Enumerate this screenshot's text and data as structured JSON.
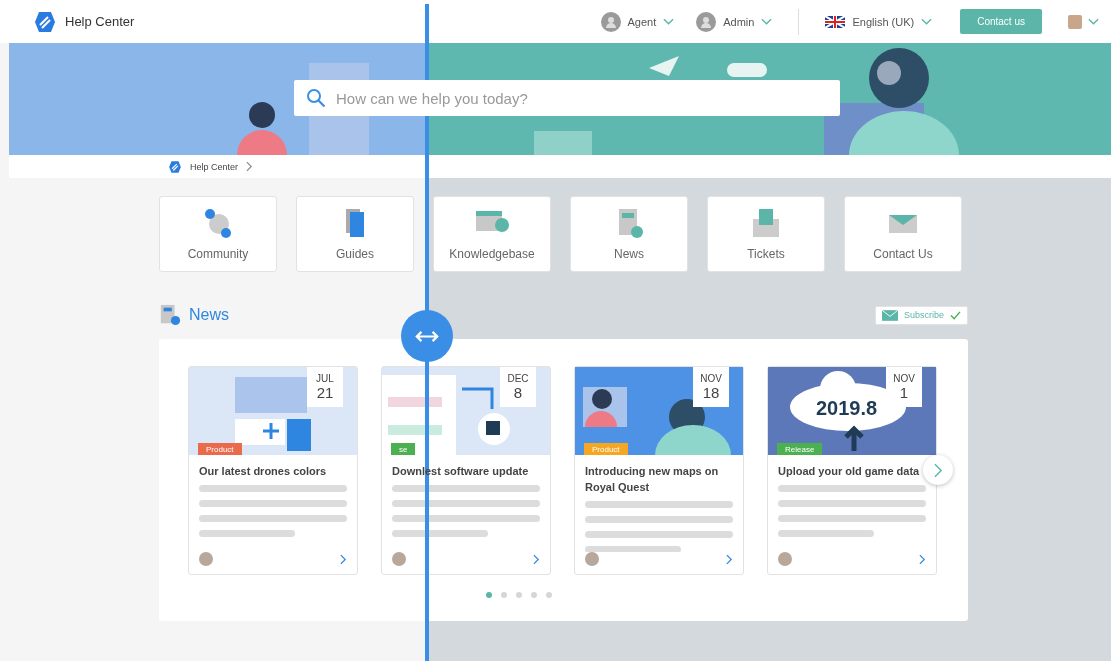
{
  "header": {
    "brand": "Help Center",
    "menus": [
      {
        "label": "Agent"
      },
      {
        "label": "Admin"
      }
    ],
    "language": "English (UK)",
    "contact_button": "Contact us"
  },
  "hero": {
    "search": {
      "placeholder": "How can we help you today?"
    }
  },
  "breadcrumb": [
    {
      "label": "Help Center"
    }
  ],
  "tiles": [
    {
      "label": "Community",
      "kind": "community"
    },
    {
      "label": "Guides",
      "kind": "guides"
    },
    {
      "label": "Knowledgebase",
      "kind": "knowledge"
    },
    {
      "label": "News",
      "kind": "news"
    },
    {
      "label": "Tickets",
      "kind": "tickets"
    },
    {
      "label": "Contact Us",
      "kind": "contact"
    }
  ],
  "news": {
    "title": "News",
    "subscribe": "Subscribe",
    "cards": [
      {
        "month": "JUL",
        "day": "21",
        "kind": "document",
        "tag": {
          "label": "Product",
          "color": "#ea6a4c"
        },
        "title": "Our latest drones colors"
      },
      {
        "month": "DEC",
        "day": "8",
        "kind": "plugin",
        "tag": {
          "label": "se",
          "color": "#4caf50"
        },
        "title": "Downlest software update"
      },
      {
        "month": "NOV",
        "day": "18",
        "kind": "support",
        "tag": {
          "label": "Product",
          "color": "#f5a623"
        },
        "title": "Introducing new maps on Royal Quest"
      },
      {
        "month": "NOV",
        "day": "1",
        "kind": "cloud",
        "image_text": "2019.8",
        "tag": {
          "label": "Release",
          "color": "#4caf50"
        },
        "title": "Upload your old game data"
      }
    ],
    "pager": [
      {
        "selected": true
      },
      {
        "selected": false
      },
      {
        "selected": false
      },
      {
        "selected": false
      },
      {
        "selected": false
      }
    ]
  }
}
